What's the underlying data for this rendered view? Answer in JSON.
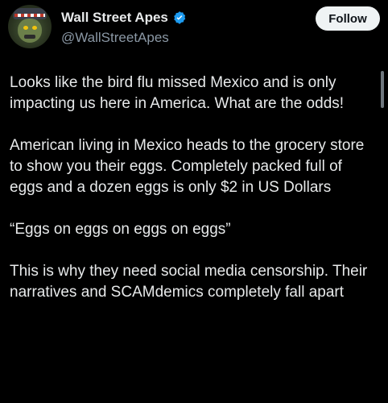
{
  "header": {
    "name": "Wall Street Apes",
    "handle": "@WallStreetApes",
    "follow_label": "Follow",
    "verified_icon": "verified-badge-icon",
    "verified_color": "#1d9bf0"
  },
  "post": {
    "paragraphs": [
      "Looks like the bird flu missed Mexico and is only impacting us here in America. What are the odds!",
      "American living in Mexico heads to the grocery store to show you their eggs. Completely packed full of eggs and a dozen eggs is only $2 in US Dollars",
      "“Eggs on eggs on eggs on eggs”",
      "This is why they need social media censorship. Their narratives and SCAMdemics completely fall apart"
    ]
  },
  "colors": {
    "background": "#000000",
    "text": "#e7e9ea",
    "secondary_text": "#8b98a5",
    "button_bg": "#eff3f4",
    "button_text": "#0f1419"
  }
}
